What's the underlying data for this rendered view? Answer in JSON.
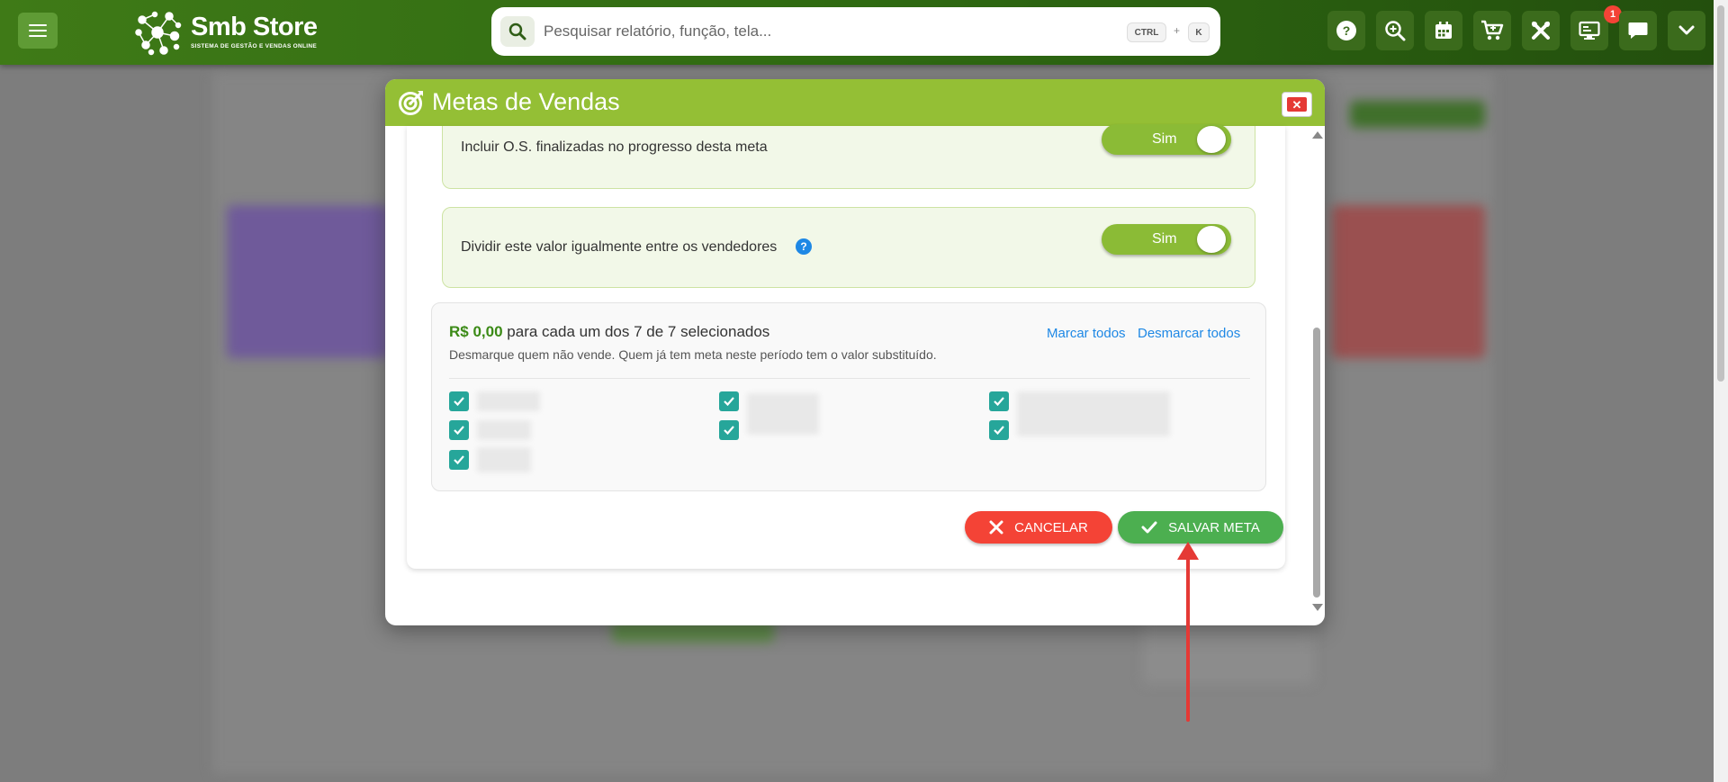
{
  "app": {
    "name": "Smb Store",
    "tagline": "SISTEMA DE GESTÃO E VENDAS ONLINE"
  },
  "search": {
    "placeholder": "Pesquisar relatório, função, tela...",
    "shortcut_key1": "CTRL",
    "shortcut_plus": "+",
    "shortcut_key2": "K"
  },
  "header_icons": [
    {
      "name": "help-icon"
    },
    {
      "name": "zoom-in-icon"
    },
    {
      "name": "calendar-icon"
    },
    {
      "name": "cart-icon"
    },
    {
      "name": "tools-icon"
    },
    {
      "name": "monitor-icon",
      "badge": "1"
    },
    {
      "name": "chat-icon"
    },
    {
      "name": "chevron-down-icon"
    }
  ],
  "modal": {
    "title": "Metas de Vendas",
    "options": [
      {
        "label": "Incluir O.S. finalizadas no progresso desta meta",
        "toggle": "Sim"
      },
      {
        "label": "Dividir este valor igualmente entre os vendedores",
        "toggle": "Sim",
        "help": "?"
      }
    ],
    "sellers": {
      "amount": "R$ 0,00",
      "amount_suffix": "para cada um dos 7 de 7 selecionados",
      "note": "Desmarque quem não vende. Quem já tem meta neste período tem o valor substituído.",
      "select_all": "Marcar todos",
      "deselect_all": "Desmarcar todos",
      "selected_count": 7
    },
    "buttons": {
      "cancel": "CANCELAR",
      "save": "SALVAR META"
    }
  },
  "colors": {
    "topbar": "#2f6a12",
    "modal_header": "#94bf35",
    "toggle_on": "#8bbb36",
    "checkbox": "#26a69a",
    "cancel": "#f44336",
    "save": "#4caf50",
    "link": "#1e88e5",
    "annotation_arrow": "#e53935"
  }
}
